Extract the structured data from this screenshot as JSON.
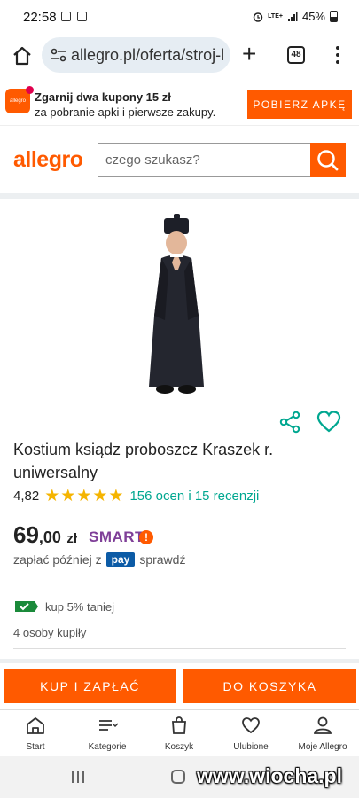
{
  "status_bar": {
    "time": "22:58",
    "network": "LTE+",
    "battery": "45%"
  },
  "browser": {
    "url": "allegro.pl/oferta/stroj-l",
    "tab_count": "48",
    "icons": [
      "home-icon",
      "site-settings-icon",
      "new-tab-icon",
      "tab-switcher-icon",
      "more-menu-icon"
    ]
  },
  "promo": {
    "logo_text": "allegro",
    "title": "Zgarnij dwa kupony 15 zł",
    "subtitle": "za pobranie apki i pierwsze zakupy.",
    "button": "POBIERZ APKĘ"
  },
  "header": {
    "logo": "allegro",
    "search_placeholder": "czego szukasz?"
  },
  "product": {
    "title": "Kostium ksiądz proboszcz Kraszek r. uniwersalny",
    "rating": "4,82",
    "stars_filled": 5,
    "stars_total": 5,
    "reviews": "156 ocen i 15 recenzji",
    "price_main": "69",
    "price_decimal": ",00",
    "currency": "zł",
    "smart_label": "SMART",
    "smart_mark": "!",
    "pay_later_prefix": "zapłać później z",
    "pay_badge": "pay",
    "pay_later_link": "sprawdź",
    "discount": "kup 5% taniej",
    "bought": "4 osoby kupiły"
  },
  "actions": {
    "buy": "KUP I ZAPŁAĆ",
    "cart": "DO KOSZYKA"
  },
  "bottom_nav": [
    {
      "label": "Start",
      "icon": "home-icon"
    },
    {
      "label": "Kategorie",
      "icon": "categories-icon"
    },
    {
      "label": "Koszyk",
      "icon": "cart-icon"
    },
    {
      "label": "Ulubione",
      "icon": "heart-icon"
    },
    {
      "label": "Moje Allegro",
      "icon": "user-icon"
    }
  ],
  "watermark": "www.wiocha.pl",
  "colors": {
    "brand": "#ff5a00",
    "rating_star": "#f5b400",
    "link": "#00a790",
    "smart": "#7f3f98",
    "pay_badge": "#0c5ba6"
  }
}
